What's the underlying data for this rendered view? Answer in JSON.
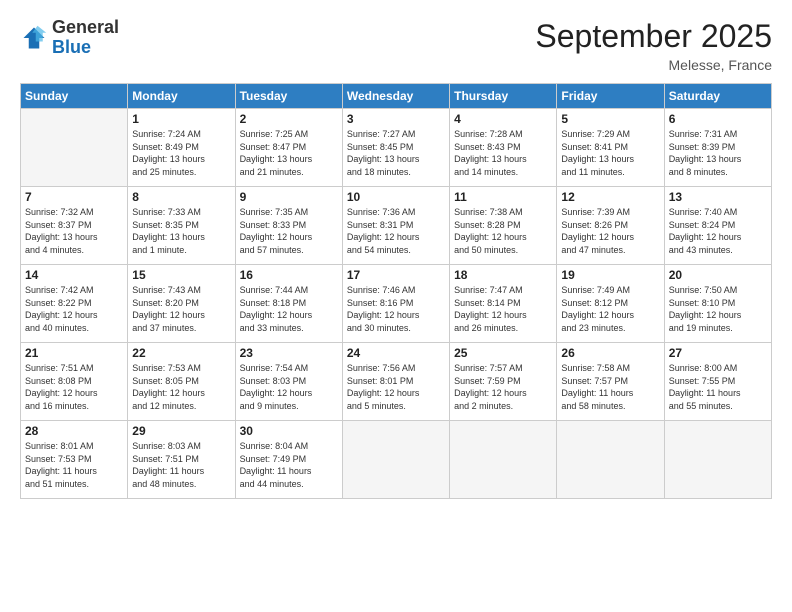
{
  "logo": {
    "general": "General",
    "blue": "Blue"
  },
  "title": "September 2025",
  "location": "Melesse, France",
  "days_header": [
    "Sunday",
    "Monday",
    "Tuesday",
    "Wednesday",
    "Thursday",
    "Friday",
    "Saturday"
  ],
  "weeks": [
    [
      {
        "day": "",
        "info": ""
      },
      {
        "day": "1",
        "info": "Sunrise: 7:24 AM\nSunset: 8:49 PM\nDaylight: 13 hours\nand 25 minutes."
      },
      {
        "day": "2",
        "info": "Sunrise: 7:25 AM\nSunset: 8:47 PM\nDaylight: 13 hours\nand 21 minutes."
      },
      {
        "day": "3",
        "info": "Sunrise: 7:27 AM\nSunset: 8:45 PM\nDaylight: 13 hours\nand 18 minutes."
      },
      {
        "day": "4",
        "info": "Sunrise: 7:28 AM\nSunset: 8:43 PM\nDaylight: 13 hours\nand 14 minutes."
      },
      {
        "day": "5",
        "info": "Sunrise: 7:29 AM\nSunset: 8:41 PM\nDaylight: 13 hours\nand 11 minutes."
      },
      {
        "day": "6",
        "info": "Sunrise: 7:31 AM\nSunset: 8:39 PM\nDaylight: 13 hours\nand 8 minutes."
      }
    ],
    [
      {
        "day": "7",
        "info": "Sunrise: 7:32 AM\nSunset: 8:37 PM\nDaylight: 13 hours\nand 4 minutes."
      },
      {
        "day": "8",
        "info": "Sunrise: 7:33 AM\nSunset: 8:35 PM\nDaylight: 13 hours\nand 1 minute."
      },
      {
        "day": "9",
        "info": "Sunrise: 7:35 AM\nSunset: 8:33 PM\nDaylight: 12 hours\nand 57 minutes."
      },
      {
        "day": "10",
        "info": "Sunrise: 7:36 AM\nSunset: 8:31 PM\nDaylight: 12 hours\nand 54 minutes."
      },
      {
        "day": "11",
        "info": "Sunrise: 7:38 AM\nSunset: 8:28 PM\nDaylight: 12 hours\nand 50 minutes."
      },
      {
        "day": "12",
        "info": "Sunrise: 7:39 AM\nSunset: 8:26 PM\nDaylight: 12 hours\nand 47 minutes."
      },
      {
        "day": "13",
        "info": "Sunrise: 7:40 AM\nSunset: 8:24 PM\nDaylight: 12 hours\nand 43 minutes."
      }
    ],
    [
      {
        "day": "14",
        "info": "Sunrise: 7:42 AM\nSunset: 8:22 PM\nDaylight: 12 hours\nand 40 minutes."
      },
      {
        "day": "15",
        "info": "Sunrise: 7:43 AM\nSunset: 8:20 PM\nDaylight: 12 hours\nand 37 minutes."
      },
      {
        "day": "16",
        "info": "Sunrise: 7:44 AM\nSunset: 8:18 PM\nDaylight: 12 hours\nand 33 minutes."
      },
      {
        "day": "17",
        "info": "Sunrise: 7:46 AM\nSunset: 8:16 PM\nDaylight: 12 hours\nand 30 minutes."
      },
      {
        "day": "18",
        "info": "Sunrise: 7:47 AM\nSunset: 8:14 PM\nDaylight: 12 hours\nand 26 minutes."
      },
      {
        "day": "19",
        "info": "Sunrise: 7:49 AM\nSunset: 8:12 PM\nDaylight: 12 hours\nand 23 minutes."
      },
      {
        "day": "20",
        "info": "Sunrise: 7:50 AM\nSunset: 8:10 PM\nDaylight: 12 hours\nand 19 minutes."
      }
    ],
    [
      {
        "day": "21",
        "info": "Sunrise: 7:51 AM\nSunset: 8:08 PM\nDaylight: 12 hours\nand 16 minutes."
      },
      {
        "day": "22",
        "info": "Sunrise: 7:53 AM\nSunset: 8:05 PM\nDaylight: 12 hours\nand 12 minutes."
      },
      {
        "day": "23",
        "info": "Sunrise: 7:54 AM\nSunset: 8:03 PM\nDaylight: 12 hours\nand 9 minutes."
      },
      {
        "day": "24",
        "info": "Sunrise: 7:56 AM\nSunset: 8:01 PM\nDaylight: 12 hours\nand 5 minutes."
      },
      {
        "day": "25",
        "info": "Sunrise: 7:57 AM\nSunset: 7:59 PM\nDaylight: 12 hours\nand 2 minutes."
      },
      {
        "day": "26",
        "info": "Sunrise: 7:58 AM\nSunset: 7:57 PM\nDaylight: 11 hours\nand 58 minutes."
      },
      {
        "day": "27",
        "info": "Sunrise: 8:00 AM\nSunset: 7:55 PM\nDaylight: 11 hours\nand 55 minutes."
      }
    ],
    [
      {
        "day": "28",
        "info": "Sunrise: 8:01 AM\nSunset: 7:53 PM\nDaylight: 11 hours\nand 51 minutes."
      },
      {
        "day": "29",
        "info": "Sunrise: 8:03 AM\nSunset: 7:51 PM\nDaylight: 11 hours\nand 48 minutes."
      },
      {
        "day": "30",
        "info": "Sunrise: 8:04 AM\nSunset: 7:49 PM\nDaylight: 11 hours\nand 44 minutes."
      },
      {
        "day": "",
        "info": ""
      },
      {
        "day": "",
        "info": ""
      },
      {
        "day": "",
        "info": ""
      },
      {
        "day": "",
        "info": ""
      }
    ]
  ]
}
